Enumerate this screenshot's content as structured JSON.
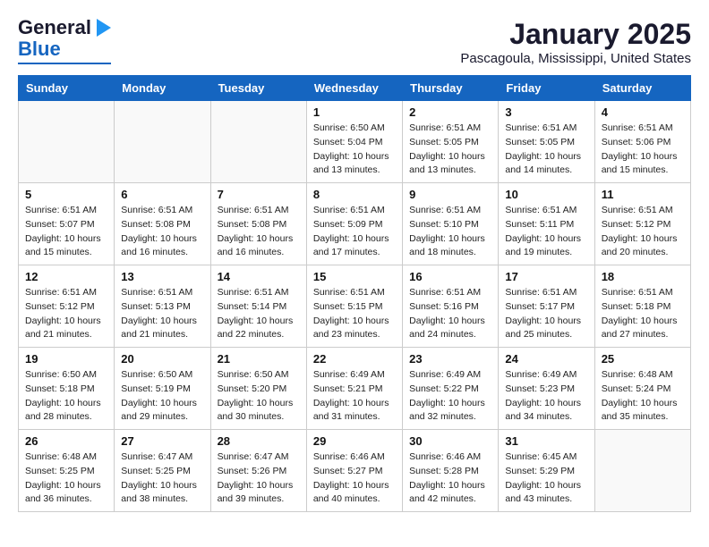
{
  "header": {
    "logo_general": "General",
    "logo_blue": "Blue",
    "month_title": "January 2025",
    "location": "Pascagoula, Mississippi, United States"
  },
  "weekdays": [
    "Sunday",
    "Monday",
    "Tuesday",
    "Wednesday",
    "Thursday",
    "Friday",
    "Saturday"
  ],
  "weeks": [
    [
      {
        "day": "",
        "sunrise": "",
        "sunset": "",
        "daylight": ""
      },
      {
        "day": "",
        "sunrise": "",
        "sunset": "",
        "daylight": ""
      },
      {
        "day": "",
        "sunrise": "",
        "sunset": "",
        "daylight": ""
      },
      {
        "day": "1",
        "sunrise": "Sunrise: 6:50 AM",
        "sunset": "Sunset: 5:04 PM",
        "daylight": "Daylight: 10 hours and 13 minutes."
      },
      {
        "day": "2",
        "sunrise": "Sunrise: 6:51 AM",
        "sunset": "Sunset: 5:05 PM",
        "daylight": "Daylight: 10 hours and 13 minutes."
      },
      {
        "day": "3",
        "sunrise": "Sunrise: 6:51 AM",
        "sunset": "Sunset: 5:05 PM",
        "daylight": "Daylight: 10 hours and 14 minutes."
      },
      {
        "day": "4",
        "sunrise": "Sunrise: 6:51 AM",
        "sunset": "Sunset: 5:06 PM",
        "daylight": "Daylight: 10 hours and 15 minutes."
      }
    ],
    [
      {
        "day": "5",
        "sunrise": "Sunrise: 6:51 AM",
        "sunset": "Sunset: 5:07 PM",
        "daylight": "Daylight: 10 hours and 15 minutes."
      },
      {
        "day": "6",
        "sunrise": "Sunrise: 6:51 AM",
        "sunset": "Sunset: 5:08 PM",
        "daylight": "Daylight: 10 hours and 16 minutes."
      },
      {
        "day": "7",
        "sunrise": "Sunrise: 6:51 AM",
        "sunset": "Sunset: 5:08 PM",
        "daylight": "Daylight: 10 hours and 16 minutes."
      },
      {
        "day": "8",
        "sunrise": "Sunrise: 6:51 AM",
        "sunset": "Sunset: 5:09 PM",
        "daylight": "Daylight: 10 hours and 17 minutes."
      },
      {
        "day": "9",
        "sunrise": "Sunrise: 6:51 AM",
        "sunset": "Sunset: 5:10 PM",
        "daylight": "Daylight: 10 hours and 18 minutes."
      },
      {
        "day": "10",
        "sunrise": "Sunrise: 6:51 AM",
        "sunset": "Sunset: 5:11 PM",
        "daylight": "Daylight: 10 hours and 19 minutes."
      },
      {
        "day": "11",
        "sunrise": "Sunrise: 6:51 AM",
        "sunset": "Sunset: 5:12 PM",
        "daylight": "Daylight: 10 hours and 20 minutes."
      }
    ],
    [
      {
        "day": "12",
        "sunrise": "Sunrise: 6:51 AM",
        "sunset": "Sunset: 5:12 PM",
        "daylight": "Daylight: 10 hours and 21 minutes."
      },
      {
        "day": "13",
        "sunrise": "Sunrise: 6:51 AM",
        "sunset": "Sunset: 5:13 PM",
        "daylight": "Daylight: 10 hours and 21 minutes."
      },
      {
        "day": "14",
        "sunrise": "Sunrise: 6:51 AM",
        "sunset": "Sunset: 5:14 PM",
        "daylight": "Daylight: 10 hours and 22 minutes."
      },
      {
        "day": "15",
        "sunrise": "Sunrise: 6:51 AM",
        "sunset": "Sunset: 5:15 PM",
        "daylight": "Daylight: 10 hours and 23 minutes."
      },
      {
        "day": "16",
        "sunrise": "Sunrise: 6:51 AM",
        "sunset": "Sunset: 5:16 PM",
        "daylight": "Daylight: 10 hours and 24 minutes."
      },
      {
        "day": "17",
        "sunrise": "Sunrise: 6:51 AM",
        "sunset": "Sunset: 5:17 PM",
        "daylight": "Daylight: 10 hours and 25 minutes."
      },
      {
        "day": "18",
        "sunrise": "Sunrise: 6:51 AM",
        "sunset": "Sunset: 5:18 PM",
        "daylight": "Daylight: 10 hours and 27 minutes."
      }
    ],
    [
      {
        "day": "19",
        "sunrise": "Sunrise: 6:50 AM",
        "sunset": "Sunset: 5:18 PM",
        "daylight": "Daylight: 10 hours and 28 minutes."
      },
      {
        "day": "20",
        "sunrise": "Sunrise: 6:50 AM",
        "sunset": "Sunset: 5:19 PM",
        "daylight": "Daylight: 10 hours and 29 minutes."
      },
      {
        "day": "21",
        "sunrise": "Sunrise: 6:50 AM",
        "sunset": "Sunset: 5:20 PM",
        "daylight": "Daylight: 10 hours and 30 minutes."
      },
      {
        "day": "22",
        "sunrise": "Sunrise: 6:49 AM",
        "sunset": "Sunset: 5:21 PM",
        "daylight": "Daylight: 10 hours and 31 minutes."
      },
      {
        "day": "23",
        "sunrise": "Sunrise: 6:49 AM",
        "sunset": "Sunset: 5:22 PM",
        "daylight": "Daylight: 10 hours and 32 minutes."
      },
      {
        "day": "24",
        "sunrise": "Sunrise: 6:49 AM",
        "sunset": "Sunset: 5:23 PM",
        "daylight": "Daylight: 10 hours and 34 minutes."
      },
      {
        "day": "25",
        "sunrise": "Sunrise: 6:48 AM",
        "sunset": "Sunset: 5:24 PM",
        "daylight": "Daylight: 10 hours and 35 minutes."
      }
    ],
    [
      {
        "day": "26",
        "sunrise": "Sunrise: 6:48 AM",
        "sunset": "Sunset: 5:25 PM",
        "daylight": "Daylight: 10 hours and 36 minutes."
      },
      {
        "day": "27",
        "sunrise": "Sunrise: 6:47 AM",
        "sunset": "Sunset: 5:25 PM",
        "daylight": "Daylight: 10 hours and 38 minutes."
      },
      {
        "day": "28",
        "sunrise": "Sunrise: 6:47 AM",
        "sunset": "Sunset: 5:26 PM",
        "daylight": "Daylight: 10 hours and 39 minutes."
      },
      {
        "day": "29",
        "sunrise": "Sunrise: 6:46 AM",
        "sunset": "Sunset: 5:27 PM",
        "daylight": "Daylight: 10 hours and 40 minutes."
      },
      {
        "day": "30",
        "sunrise": "Sunrise: 6:46 AM",
        "sunset": "Sunset: 5:28 PM",
        "daylight": "Daylight: 10 hours and 42 minutes."
      },
      {
        "day": "31",
        "sunrise": "Sunrise: 6:45 AM",
        "sunset": "Sunset: 5:29 PM",
        "daylight": "Daylight: 10 hours and 43 minutes."
      },
      {
        "day": "",
        "sunrise": "",
        "sunset": "",
        "daylight": ""
      }
    ]
  ]
}
